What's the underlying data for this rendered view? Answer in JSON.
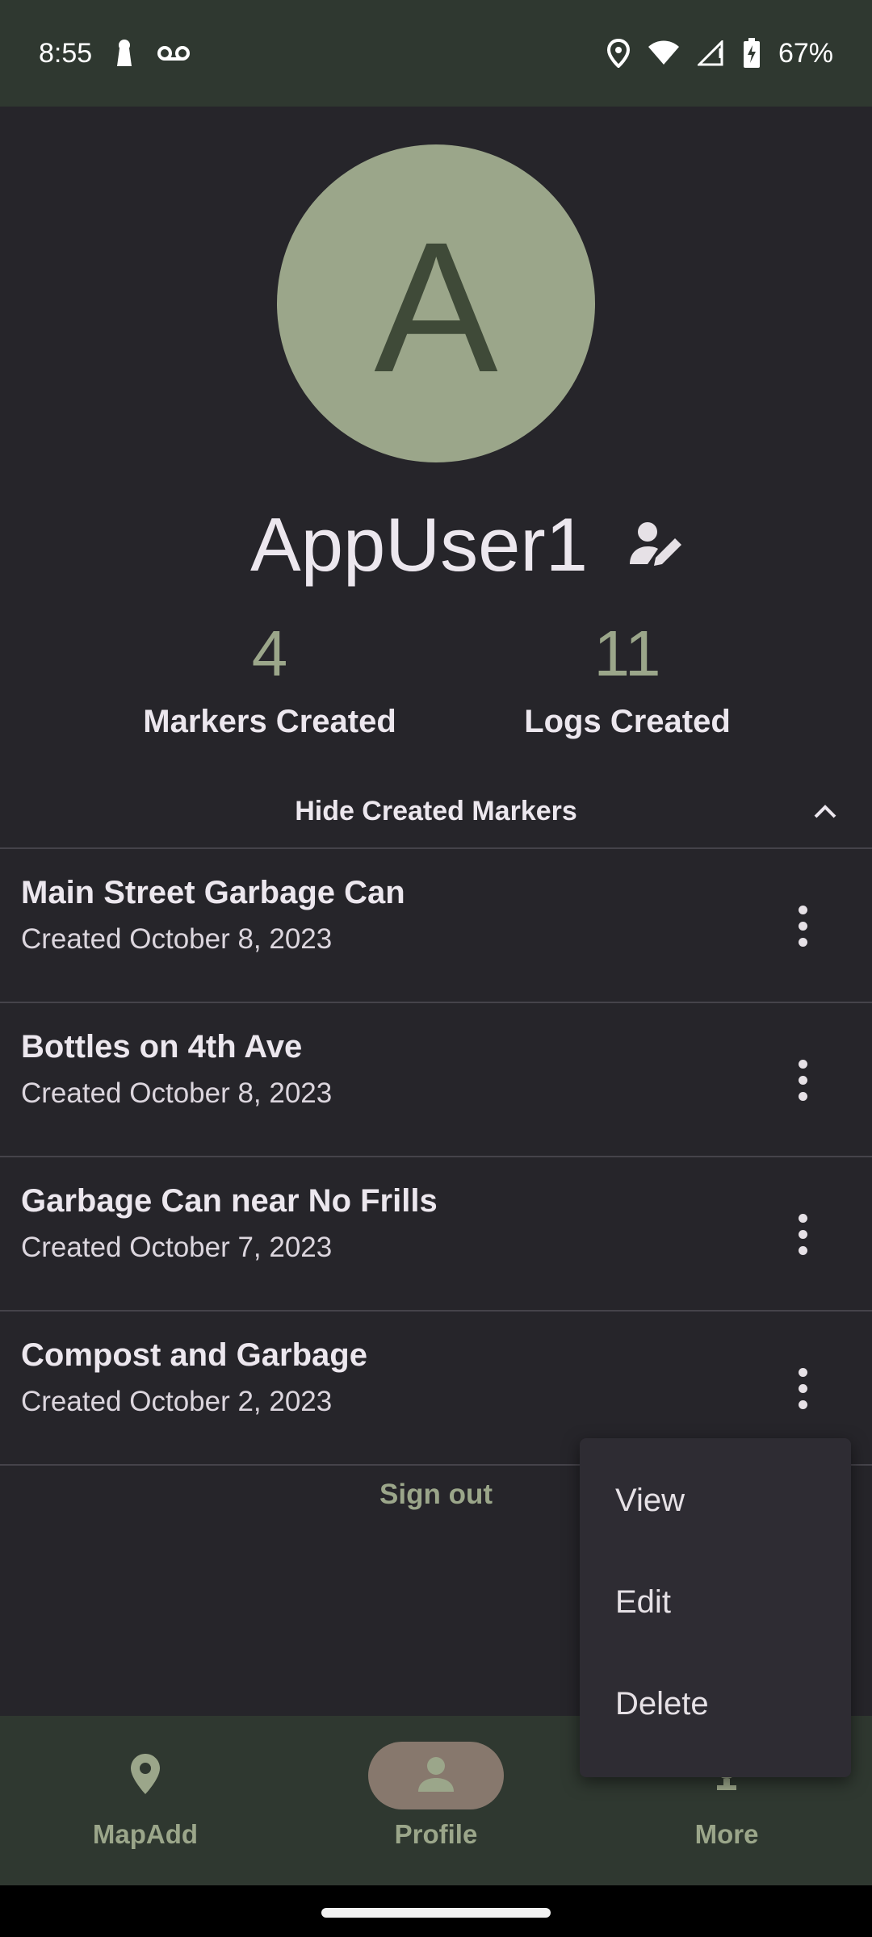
{
  "status_bar": {
    "time": "8:55",
    "battery": "67%",
    "icons": [
      "lock-keyhole-icon",
      "voicemail-icon",
      "location-icon",
      "wifi-icon",
      "signal-icon",
      "battery-charging-icon"
    ]
  },
  "profile": {
    "avatar_letter": "A",
    "username": "AppUser1"
  },
  "stats": {
    "markers_count": "4",
    "markers_label": "Markers Created",
    "logs_count": "11",
    "logs_label": "Logs Created"
  },
  "toggle": {
    "label": "Hide Created Markers"
  },
  "markers": [
    {
      "title": "Main Street Garbage Can",
      "date": "Created October 8, 2023"
    },
    {
      "title": "Bottles on 4th Ave",
      "date": "Created October 8, 2023"
    },
    {
      "title": "Garbage Can near No Frills",
      "date": "Created October 7, 2023"
    },
    {
      "title": "Compost and Garbage",
      "date": "Created October 2, 2023"
    }
  ],
  "sign_out_label": "Sign out",
  "popup_menu": {
    "items": [
      "View",
      "Edit",
      "Delete"
    ]
  },
  "bottom_nav": {
    "items": [
      {
        "label": "MapAdd",
        "icon": "map-pin-icon",
        "active": false
      },
      {
        "label": "Profile",
        "icon": "person-icon",
        "active": true
      },
      {
        "label": "More",
        "icon": "trophy-icon",
        "active": false
      }
    ]
  },
  "colors": {
    "background": "#26252a",
    "bars": "#2f3830",
    "accent": "#9ba68a",
    "active_pill": "#87786d"
  }
}
